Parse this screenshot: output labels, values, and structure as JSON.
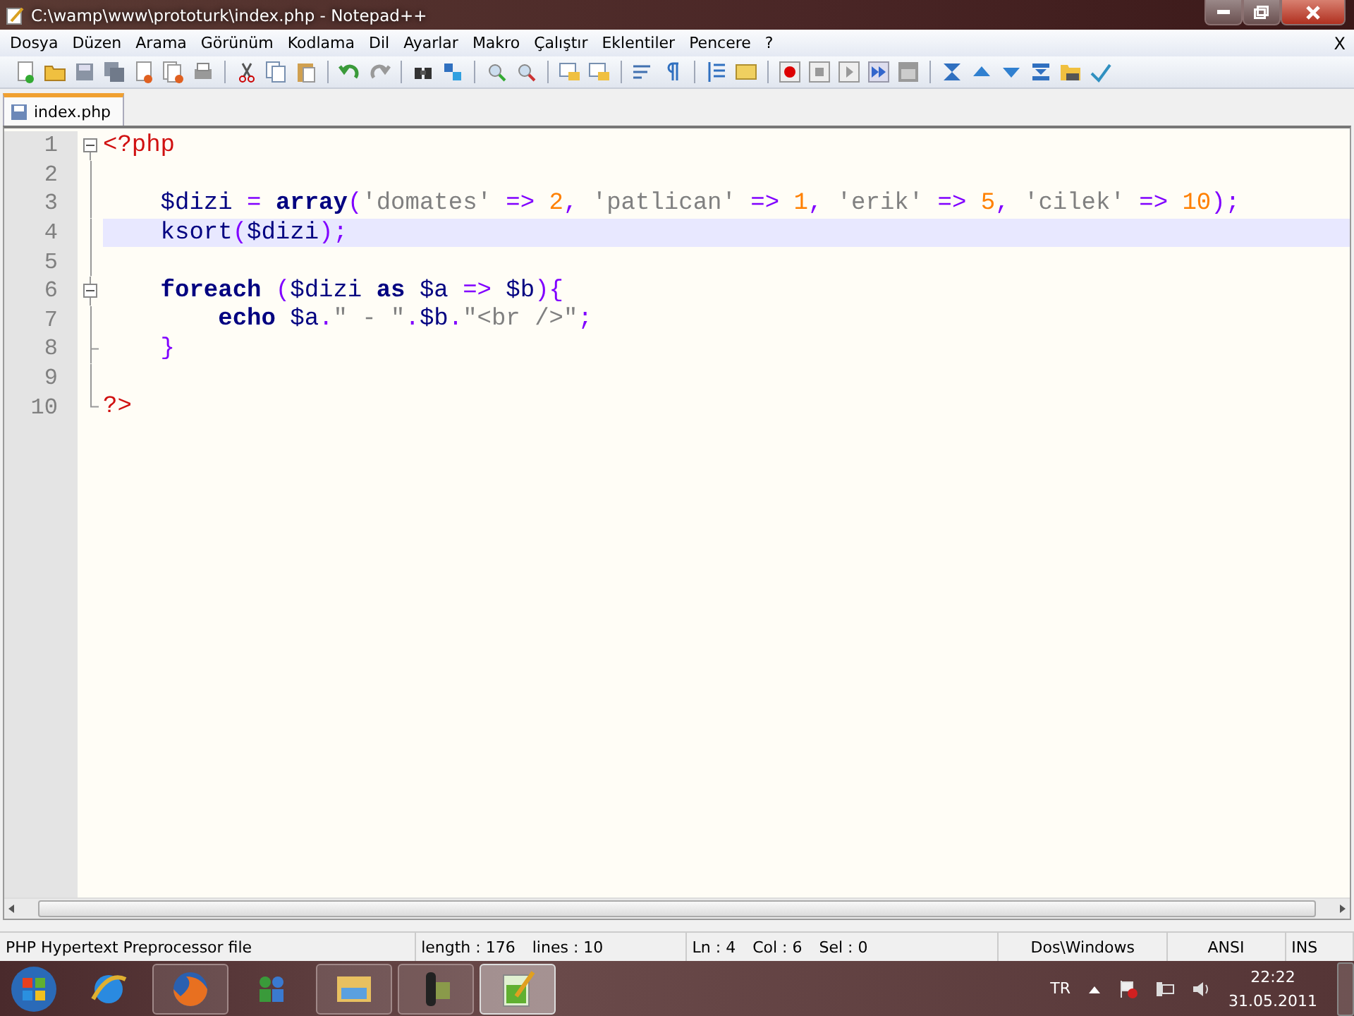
{
  "window": {
    "title": "C:\\wamp\\www\\prototurk\\index.php - Notepad++"
  },
  "menu": [
    {
      "label": "Dosya"
    },
    {
      "label": "Düzen"
    },
    {
      "label": "Arama"
    },
    {
      "label": "Görünüm"
    },
    {
      "label": "Kodlama"
    },
    {
      "label": "Dil"
    },
    {
      "label": "Ayarlar"
    },
    {
      "label": "Makro"
    },
    {
      "label": "Çalıştır"
    },
    {
      "label": "Eklentiler"
    },
    {
      "label": "Pencere"
    },
    {
      "label": "?"
    }
  ],
  "menu_close": "X",
  "tabs": [
    {
      "label": "index.php",
      "selected": true
    }
  ],
  "editor": {
    "lines": [
      {
        "number": "1",
        "kind": "open",
        "current": false,
        "tokens": [
          {
            "kind": "tag",
            "text": "<?php"
          }
        ]
      },
      {
        "number": "2",
        "kind": "body",
        "current": false
      },
      {
        "number": "3",
        "kind": "body",
        "current": false,
        "tokens": [
          {
            "kind": "var",
            "text": "    $dizi"
          },
          {
            "kind": "op",
            "text": " = "
          },
          {
            "kind": "keyword",
            "text": "array"
          },
          {
            "kind": "op",
            "text": "("
          },
          {
            "kind": "string",
            "text": "'domates'"
          },
          {
            "kind": "op",
            "text": " => "
          },
          {
            "kind": "number",
            "text": "2"
          },
          {
            "kind": "op",
            "text": ", "
          },
          {
            "kind": "string",
            "text": "'patlican'"
          },
          {
            "kind": "op",
            "text": " => "
          },
          {
            "kind": "number",
            "text": "1"
          },
          {
            "kind": "op",
            "text": ", "
          },
          {
            "kind": "string",
            "text": "'erik'"
          },
          {
            "kind": "op",
            "text": " => "
          },
          {
            "kind": "number",
            "text": "5"
          },
          {
            "kind": "op",
            "text": ", "
          },
          {
            "kind": "string",
            "text": "'cilek'"
          },
          {
            "kind": "op",
            "text": " => "
          },
          {
            "kind": "number",
            "text": "10"
          },
          {
            "kind": "op",
            "text": ");"
          }
        ]
      },
      {
        "number": "4",
        "kind": "body",
        "current": true,
        "tokens": [
          {
            "kind": "var",
            "text": "    ksort"
          },
          {
            "kind": "op",
            "text": "("
          },
          {
            "kind": "var",
            "text": "$dizi"
          },
          {
            "kind": "op",
            "text": ");"
          }
        ]
      },
      {
        "number": "5",
        "kind": "body",
        "current": false
      },
      {
        "number": "6",
        "kind": "open",
        "current": false,
        "tokens": [
          {
            "kind": "keyword",
            "text": "    foreach"
          },
          {
            "kind": "op",
            "text": " ("
          },
          {
            "kind": "var",
            "text": "$dizi "
          },
          {
            "kind": "keyword",
            "text": "as"
          },
          {
            "kind": "var",
            "text": " $a "
          },
          {
            "kind": "op",
            "text": "=>"
          },
          {
            "kind": "var",
            "text": " $b"
          },
          {
            "kind": "op",
            "text": "){"
          }
        ]
      },
      {
        "number": "7",
        "kind": "body",
        "current": false,
        "tokens": [
          {
            "kind": "keyword",
            "text": "        echo"
          },
          {
            "kind": "var",
            "text": " $a"
          },
          {
            "kind": "op",
            "text": "."
          },
          {
            "kind": "string",
            "text": "\" - \""
          },
          {
            "kind": "op",
            "text": "."
          },
          {
            "kind": "var",
            "text": "$b"
          },
          {
            "kind": "op",
            "text": "."
          },
          {
            "kind": "string",
            "text": "\"<br />\""
          },
          {
            "kind": "op",
            "text": ";"
          }
        ]
      },
      {
        "number": "8",
        "kind": "close",
        "current": false,
        "tokens": [
          {
            "kind": "op",
            "text": "    }"
          }
        ]
      },
      {
        "number": "9",
        "kind": "body",
        "current": false
      },
      {
        "number": "10",
        "kind": "close",
        "current": false,
        "tokens": [
          {
            "kind": "tag",
            "text": "?>"
          }
        ]
      }
    ]
  },
  "status_bar": [
    {
      "texts": [
        "PHP Hypertext Preprocessor file"
      ]
    },
    {
      "texts": [
        "length : 176",
        "lines : 10"
      ]
    },
    {
      "texts": [
        "Ln : 4",
        "Col : 6",
        "Sel : 0"
      ]
    },
    {
      "texts": [
        "Dos\\Windows"
      ]
    },
    {
      "texts": [
        "ANSI"
      ]
    },
    {
      "texts": [
        "INS"
      ]
    }
  ],
  "taskbar": {
    "apps": [
      {
        "kind": "ie",
        "running": false,
        "selected": false
      },
      {
        "kind": "firefox",
        "running": true,
        "selected": false
      },
      {
        "kind": "messenger",
        "running": false,
        "selected": false
      },
      {
        "kind": "explorer",
        "running": true,
        "selected": false
      },
      {
        "kind": "media",
        "running": true,
        "selected": false
      },
      {
        "kind": "notepad",
        "running": true,
        "selected": true
      }
    ],
    "language": "TR",
    "time": "22:22",
    "date": "31.05.2011"
  }
}
